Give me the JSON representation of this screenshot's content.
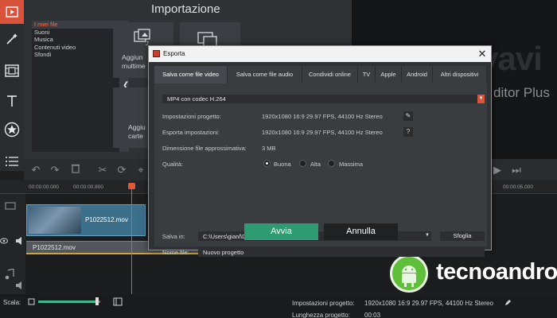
{
  "import_panel": {
    "title": "Importazione",
    "categories": [
      "I miei file",
      "Suoni",
      "Musica",
      "Contenuti video",
      "Sfondi"
    ],
    "tile1_label_line1": "Aggiun",
    "tile1_label_line2": "multime",
    "tile2_label_line1": "Aggiu",
    "tile2_label_line2": "carte"
  },
  "preview": {
    "logo": "movavi",
    "subtitle": "ditor Plus"
  },
  "timeline": {
    "ruler_labels": [
      "00:00:00.000",
      "00:00:00.800",
      "00:00:05.000"
    ],
    "video_clip_name": "P1022512.mov",
    "audio_clip_name": "P1022512.mov"
  },
  "status": {
    "scale_label": "Scala:",
    "zoom_fraction": 0.95,
    "project_settings_label": "Impostazioni progetto:",
    "project_settings_value": "1920x1080 16:9 29.97 FPS, 44100 Hz Stereo",
    "project_length_label": "Lunghezza progetto:",
    "project_length_value": "00:03"
  },
  "watermark": {
    "text_part1": "tecno",
    "text_part2": "android"
  },
  "dialog": {
    "title": "Esporta",
    "close_glyph": "✕",
    "tabs": [
      "Salva come file video",
      "Salva come file audio",
      "Condividi online",
      "TV",
      "Apple",
      "Android",
      "Altri dispositivi"
    ],
    "format_value": "MP4 con codec H.264",
    "project_settings_label": "Impostazioni progetto:",
    "project_settings_value": "1920x1080 16:9 29.97 FPS, 44100 Hz Stereo",
    "export_settings_label": "Esporta impostazioni:",
    "export_settings_value": "1920x1080 16:9 29.97 FPS, 44100 Hz Stereo",
    "help_glyph": "?",
    "file_size_label": "Dimensione file approssimativa:",
    "file_size_value": "3 MB",
    "quality_label": "Qualità:",
    "quality_options": [
      "Buona",
      "Alta",
      "Massima"
    ],
    "save_in_label": "Salva in:",
    "save_path": "C:\\Users\\gianl\\Desktop",
    "browse_label": "Sfoglia",
    "file_name_label": "Nome file:",
    "file_name_value": "Nuovo progetto",
    "ok_label": "Avvia",
    "cancel_label": "Annulla"
  },
  "colors": {
    "accent": "#d9533c",
    "ok_button": "#2e9b72"
  }
}
